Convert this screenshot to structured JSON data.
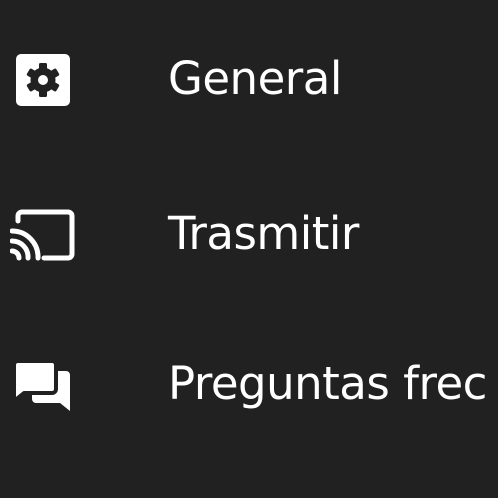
{
  "settings_menu": {
    "items": [
      {
        "icon": "gear-icon",
        "label": "General"
      },
      {
        "icon": "cast-icon",
        "label": "Trasmitir"
      },
      {
        "icon": "chat-bubbles-icon",
        "label": "Preguntas frec"
      }
    ]
  },
  "colors": {
    "background": "#212121",
    "foreground": "#ffffff"
  }
}
